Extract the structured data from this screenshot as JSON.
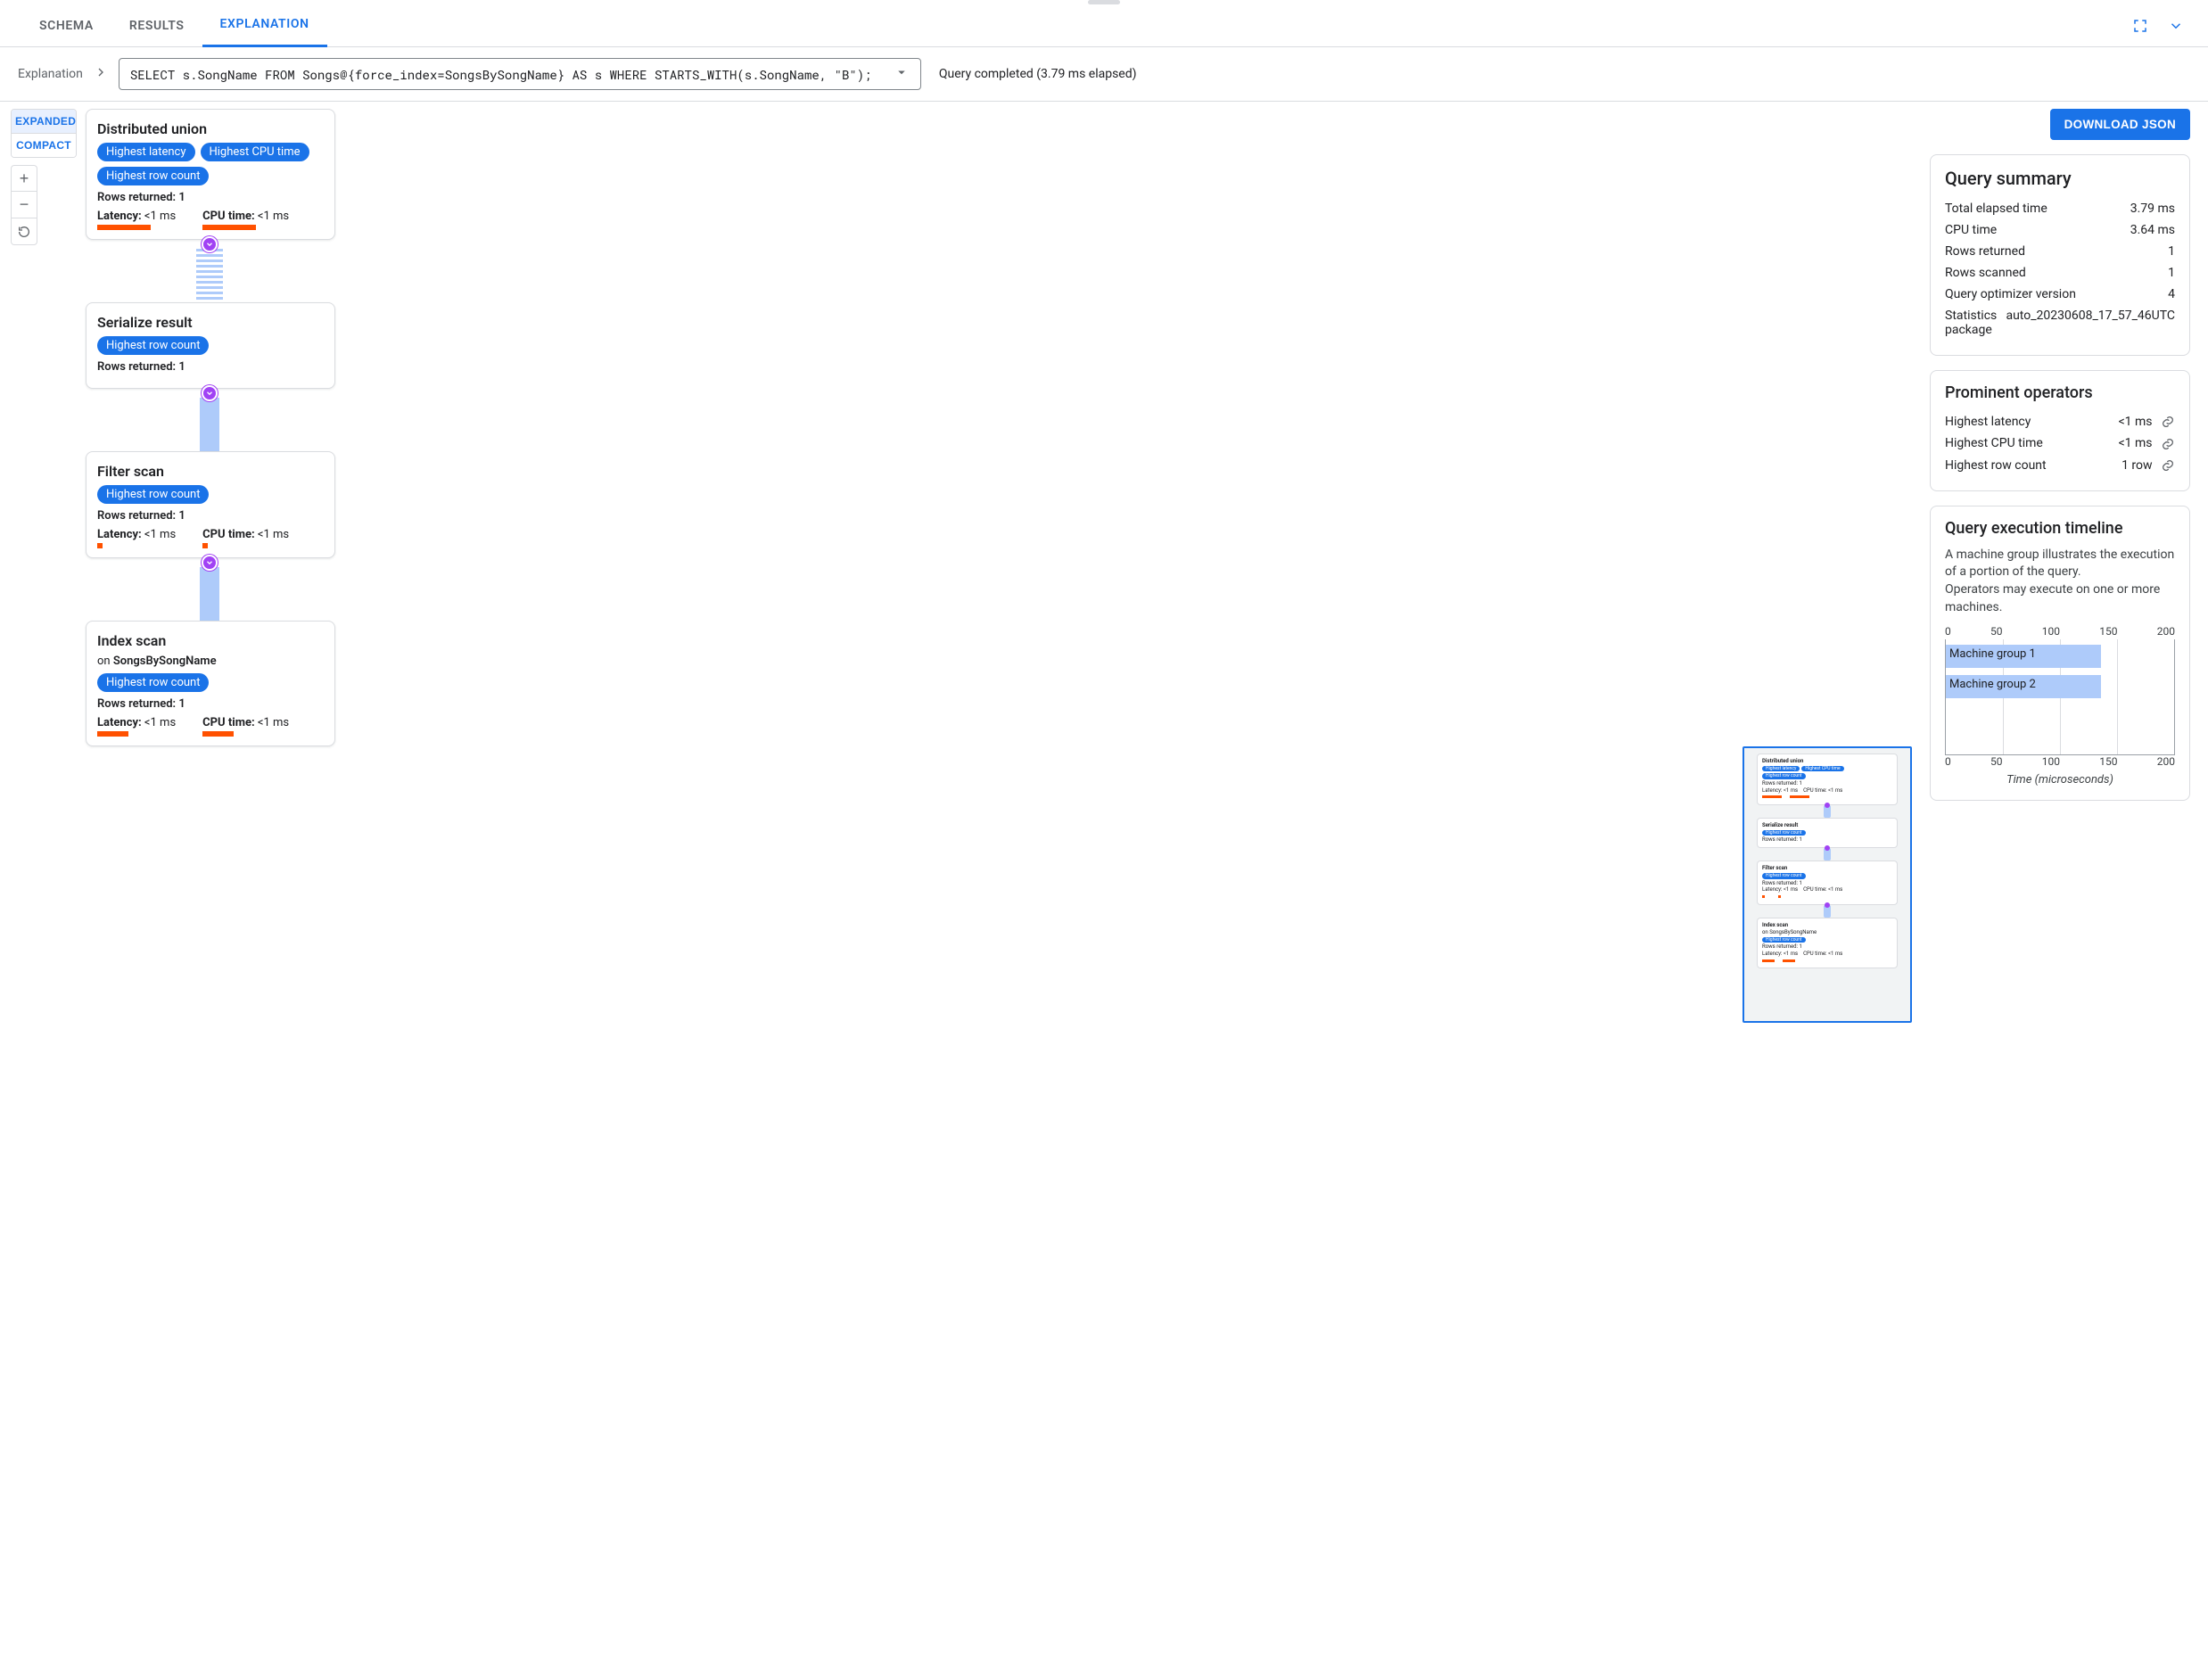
{
  "tabs": {
    "schema": "SCHEMA",
    "results": "RESULTS",
    "explanation": "EXPLANATION"
  },
  "breadcrumb": {
    "label": "Explanation"
  },
  "query": {
    "text": "SELECT s.SongName FROM Songs@{force_index=SongsBySongName} AS s WHERE STARTS_WITH(s.SongName, \"B\");",
    "status": "Query completed (3.79 ms elapsed)"
  },
  "viewModes": {
    "expanded": "EXPANDED",
    "compact": "COMPACT"
  },
  "downloadJson": "DOWNLOAD JSON",
  "plan": {
    "nodes": [
      {
        "title": "Distributed union",
        "pills": [
          "Highest latency",
          "Highest CPU time",
          "Highest row count"
        ],
        "rows": "Rows returned: 1",
        "latencyLabel": "Latency:",
        "latencyVal": "<1 ms",
        "cpuLabel": "CPU time:",
        "cpuVal": "<1 ms",
        "barW1": "w60",
        "barW2": "w60",
        "connector": "stripes"
      },
      {
        "title": "Serialize result",
        "pills": [
          "Highest row count"
        ],
        "rows": "Rows returned: 1",
        "connector": "pipe"
      },
      {
        "title": "Filter scan",
        "pills": [
          "Highest row count"
        ],
        "rows": "Rows returned: 1",
        "latencyLabel": "Latency:",
        "latencyVal": "<1 ms",
        "cpuLabel": "CPU time:",
        "cpuVal": "<1 ms",
        "barW1": "w5",
        "barW2": "w5",
        "connector": "pipe"
      },
      {
        "title": "Index scan",
        "subPrefix": "on ",
        "subBold": "SongsBySongName",
        "pills": [
          "Highest row count"
        ],
        "rows": "Rows returned: 1",
        "latencyLabel": "Latency:",
        "latencyVal": "<1 ms",
        "cpuLabel": "CPU time:",
        "cpuVal": "<1 ms",
        "barW1": "w35",
        "barW2": "w35"
      }
    ]
  },
  "summary": {
    "title": "Query summary",
    "rows": [
      {
        "k": "Total elapsed time",
        "v": "3.79 ms"
      },
      {
        "k": "CPU time",
        "v": "3.64 ms"
      },
      {
        "k": "Rows returned",
        "v": "1"
      },
      {
        "k": "Rows scanned",
        "v": "1"
      },
      {
        "k": "Query optimizer version",
        "v": "4"
      },
      {
        "k": "Statistics package",
        "v": "auto_20230608_17_57_46UTC"
      }
    ]
  },
  "prominent": {
    "title": "Prominent operators",
    "rows": [
      {
        "k": "Highest latency",
        "v": "<1 ms"
      },
      {
        "k": "Highest CPU time",
        "v": "<1 ms"
      },
      {
        "k": "Highest row count",
        "v": "1 row"
      }
    ]
  },
  "timeline": {
    "title": "Query execution timeline",
    "desc1": "A machine group illustrates the execution of a portion of the query.",
    "desc2": "Operators may execute on one or more machines.",
    "ticks": [
      "0",
      "50",
      "100",
      "150",
      "200"
    ],
    "groups": [
      {
        "label": "Machine group 1",
        "width": 68
      },
      {
        "label": "Machine group 2",
        "width": 68
      }
    ],
    "xlabel": "Time (microseconds)"
  },
  "chart_data": {
    "type": "bar",
    "orientation": "horizontal",
    "title": "Query execution timeline",
    "xlabel": "Time (microseconds)",
    "ylabel": "",
    "xlim": [
      0,
      200
    ],
    "categories": [
      "Machine group 1",
      "Machine group 2"
    ],
    "values": [
      140,
      140
    ]
  }
}
